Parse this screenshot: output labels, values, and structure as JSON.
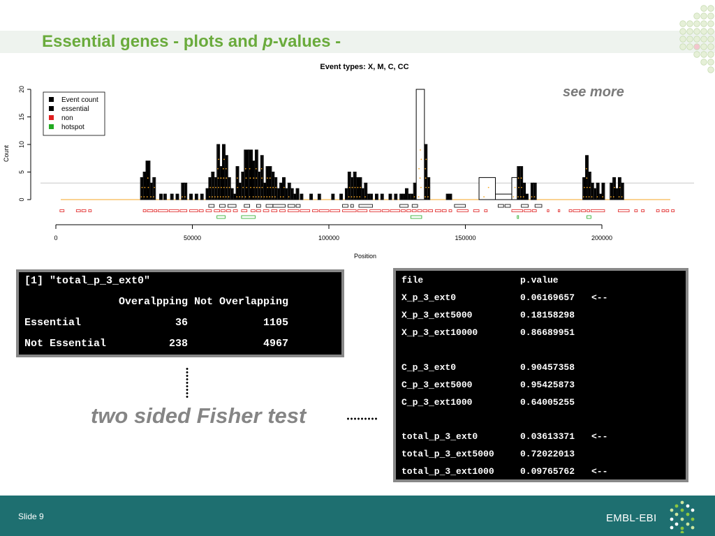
{
  "slide": {
    "title_part1": "Essential genes - plots and ",
    "title_italic": "p",
    "title_part2": "-values -",
    "see_more": "see more",
    "fisher_label": "two sided Fisher test",
    "footer_left": "Slide 9",
    "brand": "EMBL-EBI"
  },
  "colors": {
    "title_green": "#6aab3c",
    "footer_teal": "#1e6f70",
    "event_orange": "#f5a623",
    "non_red": "#e02020",
    "hotspot_green": "#22aa22"
  },
  "console1": {
    "line1": "[1] \"total_p_3_ext0\"",
    "line2": "               Overalpping Not Overlapping",
    "line3": "Essential               36            1105",
    "line4": "Not Essential          238            4967"
  },
  "console2": {
    "header": {
      "file": "file",
      "pvalue": "p.value"
    },
    "rows": [
      {
        "file": "X_p_3_ext0",
        "pvalue": "0.06169657",
        "marker": "<--"
      },
      {
        "file": "X_p_3_ext5000",
        "pvalue": "0.18158298",
        "marker": ""
      },
      {
        "file": "X_p_3_ext10000",
        "pvalue": "0.86689951",
        "marker": ""
      },
      {
        "file": "C_p_3_ext0",
        "pvalue": "0.90457358",
        "marker": ""
      },
      {
        "file": "C_p_3_ext5000",
        "pvalue": "0.95425873",
        "marker": ""
      },
      {
        "file": "C_p_3_ext1000",
        "pvalue": "0.64005255",
        "marker": ""
      },
      {
        "file": "total_p_3_ext0",
        "pvalue": "0.03613371",
        "marker": "<--"
      },
      {
        "file": "total_p_3_ext5000",
        "pvalue": "0.72022013",
        "marker": ""
      },
      {
        "file": "total_p_3_ext1000",
        "pvalue": "0.09765762",
        "marker": "<--"
      }
    ]
  },
  "chart_data": {
    "type": "bar",
    "title": "Event types: X, M, C, CC",
    "xlabel": "Position",
    "ylabel": "Count",
    "xlim": [
      0,
      235000
    ],
    "ylim": [
      0,
      20
    ],
    "x_ticks": [
      0,
      50000,
      100000,
      150000,
      200000
    ],
    "y_ticks": [
      0,
      5,
      10,
      15,
      20
    ],
    "baseline_y": 3,
    "legend": {
      "placement": "top-left",
      "items": [
        {
          "label": "Event count",
          "color": "#000000"
        },
        {
          "label": "essential",
          "color": "#000000"
        },
        {
          "label": "non",
          "color": "#e02020"
        },
        {
          "label": "hotspot",
          "color": "#22aa22"
        }
      ]
    },
    "series": [
      {
        "name": "Event count",
        "bars": [
          [
            31000,
            32000,
            4
          ],
          [
            32000,
            33000,
            5
          ],
          [
            33000,
            34500,
            7
          ],
          [
            34500,
            35500,
            3
          ],
          [
            35500,
            36500,
            4
          ],
          [
            38000,
            39000,
            1
          ],
          [
            39500,
            40500,
            1
          ],
          [
            42000,
            43000,
            1
          ],
          [
            44000,
            45000,
            1
          ],
          [
            46000,
            47000,
            3
          ],
          [
            47000,
            48000,
            3
          ],
          [
            49000,
            50000,
            1
          ],
          [
            51000,
            52000,
            1
          ],
          [
            53000,
            54000,
            1
          ],
          [
            55000,
            56000,
            2
          ],
          [
            56000,
            57000,
            4
          ],
          [
            57000,
            58000,
            5
          ],
          [
            58000,
            59000,
            4
          ],
          [
            59000,
            60000,
            10
          ],
          [
            60000,
            61000,
            6
          ],
          [
            61000,
            62000,
            10
          ],
          [
            62000,
            63000,
            8
          ],
          [
            63000,
            64000,
            4
          ],
          [
            64000,
            65000,
            2
          ],
          [
            65000,
            66000,
            1
          ],
          [
            66000,
            67000,
            6
          ],
          [
            67000,
            68000,
            3
          ],
          [
            68000,
            69000,
            5
          ],
          [
            69000,
            70500,
            9
          ],
          [
            70500,
            72000,
            9
          ],
          [
            72000,
            73000,
            7
          ],
          [
            73000,
            74000,
            9
          ],
          [
            74000,
            75000,
            5
          ],
          [
            75000,
            76000,
            8
          ],
          [
            76000,
            77000,
            3
          ],
          [
            77000,
            78000,
            6
          ],
          [
            78000,
            79000,
            6
          ],
          [
            79000,
            80000,
            5
          ],
          [
            80000,
            81000,
            4
          ],
          [
            81000,
            82000,
            2
          ],
          [
            82000,
            83000,
            3
          ],
          [
            83000,
            84000,
            4
          ],
          [
            84000,
            85000,
            2
          ],
          [
            85000,
            86000,
            3
          ],
          [
            86000,
            87000,
            2
          ],
          [
            87000,
            88000,
            1
          ],
          [
            88000,
            89000,
            2
          ],
          [
            89500,
            90500,
            1
          ],
          [
            93000,
            94000,
            1
          ],
          [
            96000,
            97000,
            1
          ],
          [
            101000,
            102000,
            1
          ],
          [
            104000,
            105000,
            1
          ],
          [
            106000,
            107000,
            2
          ],
          [
            107000,
            108000,
            5
          ],
          [
            108000,
            109000,
            4
          ],
          [
            109000,
            110000,
            5
          ],
          [
            110000,
            111000,
            4
          ],
          [
            111000,
            112000,
            4
          ],
          [
            112000,
            113000,
            2
          ],
          [
            113000,
            114000,
            3
          ],
          [
            114000,
            115000,
            1
          ],
          [
            115000,
            116000,
            1
          ],
          [
            117000,
            118000,
            1
          ],
          [
            119000,
            120000,
            1
          ],
          [
            122000,
            123000,
            1
          ],
          [
            124000,
            125000,
            1
          ],
          [
            126000,
            127000,
            1
          ],
          [
            127000,
            128000,
            1
          ],
          [
            128000,
            129000,
            2
          ],
          [
            129000,
            130000,
            1
          ],
          [
            130000,
            131000,
            1
          ],
          [
            131000,
            132000,
            3
          ],
          [
            132000,
            135000,
            20
          ],
          [
            135000,
            136000,
            10
          ],
          [
            136000,
            137000,
            4
          ],
          [
            143000,
            144000,
            1
          ],
          [
            144000,
            145000,
            1
          ],
          [
            155000,
            161000,
            4
          ],
          [
            161000,
            167000,
            1
          ],
          [
            167000,
            169000,
            4
          ],
          [
            169000,
            170000,
            6
          ],
          [
            170000,
            171000,
            6
          ],
          [
            171000,
            172000,
            3
          ],
          [
            172000,
            173000,
            1
          ],
          [
            174000,
            175000,
            3
          ],
          [
            175000,
            176000,
            3
          ],
          [
            193000,
            194000,
            4
          ],
          [
            194000,
            195000,
            8
          ],
          [
            195000,
            196000,
            5
          ],
          [
            196000,
            197000,
            3
          ],
          [
            197000,
            198000,
            2
          ],
          [
            198000,
            199000,
            3
          ],
          [
            199000,
            200000,
            1
          ],
          [
            200000,
            201000,
            3
          ],
          [
            203000,
            204000,
            3
          ],
          [
            204000,
            205000,
            4
          ],
          [
            205000,
            206000,
            2
          ],
          [
            206000,
            207000,
            4
          ],
          [
            207000,
            208000,
            3
          ]
        ]
      },
      {
        "name": "essential",
        "intervals": [
          [
            56000,
            58000
          ],
          [
            60000,
            62000
          ],
          [
            63000,
            66000
          ],
          [
            69000,
            71000
          ],
          [
            73500,
            75000
          ],
          [
            77000,
            79500
          ],
          [
            79500,
            84000
          ],
          [
            85000,
            87500
          ],
          [
            88000,
            89500
          ],
          [
            105000,
            107000
          ],
          [
            108000,
            109000
          ],
          [
            111000,
            116000
          ],
          [
            126000,
            129000
          ],
          [
            130500,
            132500
          ],
          [
            146000,
            150000
          ],
          [
            162000,
            164000
          ],
          [
            164500,
            166500
          ],
          [
            170500,
            173000
          ],
          [
            175500,
            178000
          ]
        ]
      },
      {
        "name": "non",
        "intervals": [
          [
            1500,
            3000
          ],
          [
            7500,
            9000
          ],
          [
            9500,
            11000
          ],
          [
            12000,
            13000
          ],
          [
            32000,
            33000
          ],
          [
            33500,
            35500
          ],
          [
            36000,
            37000
          ],
          [
            37500,
            41000
          ],
          [
            41500,
            45000
          ],
          [
            45500,
            48000
          ],
          [
            49000,
            52000
          ],
          [
            52500,
            54000
          ],
          [
            55000,
            57000
          ],
          [
            58000,
            60000
          ],
          [
            60500,
            62000
          ],
          [
            62500,
            64000
          ],
          [
            65000,
            66500
          ],
          [
            68000,
            70000
          ],
          [
            71500,
            73000
          ],
          [
            73500,
            75000
          ],
          [
            76000,
            78000
          ],
          [
            79000,
            81000
          ],
          [
            82000,
            84000
          ],
          [
            85000,
            89000
          ],
          [
            89500,
            93000
          ],
          [
            94000,
            96000
          ],
          [
            96500,
            100000
          ],
          [
            100500,
            104000
          ],
          [
            105000,
            110000
          ],
          [
            110500,
            114000
          ],
          [
            115000,
            119000
          ],
          [
            119500,
            122000
          ],
          [
            122500,
            126000
          ],
          [
            126500,
            128000
          ],
          [
            128500,
            130000
          ],
          [
            130500,
            132000
          ],
          [
            132500,
            134000
          ],
          [
            134500,
            136000
          ],
          [
            136500,
            138000
          ],
          [
            139000,
            141000
          ],
          [
            141500,
            143000
          ],
          [
            144000,
            145000
          ],
          [
            147000,
            151000
          ],
          [
            153000,
            155000
          ],
          [
            157000,
            158000
          ],
          [
            167000,
            171000
          ],
          [
            171500,
            174000
          ],
          [
            174500,
            176000
          ],
          [
            180000,
            180600
          ],
          [
            184000,
            184600
          ],
          [
            188000,
            189000
          ],
          [
            189500,
            192000
          ],
          [
            192500,
            194000
          ],
          [
            194500,
            195500
          ],
          [
            196000,
            201000
          ],
          [
            206000,
            210000
          ],
          [
            212000,
            213000
          ],
          [
            214500,
            215500
          ],
          [
            220000,
            221000
          ],
          [
            222000,
            223000
          ],
          [
            223500,
            224500
          ],
          [
            225500,
            226500
          ]
        ]
      },
      {
        "name": "hotspot",
        "intervals": [
          [
            59000,
            62000
          ],
          [
            68000,
            73000
          ],
          [
            130000,
            134000
          ],
          [
            169000,
            169500
          ],
          [
            194500,
            196000
          ]
        ]
      }
    ]
  }
}
